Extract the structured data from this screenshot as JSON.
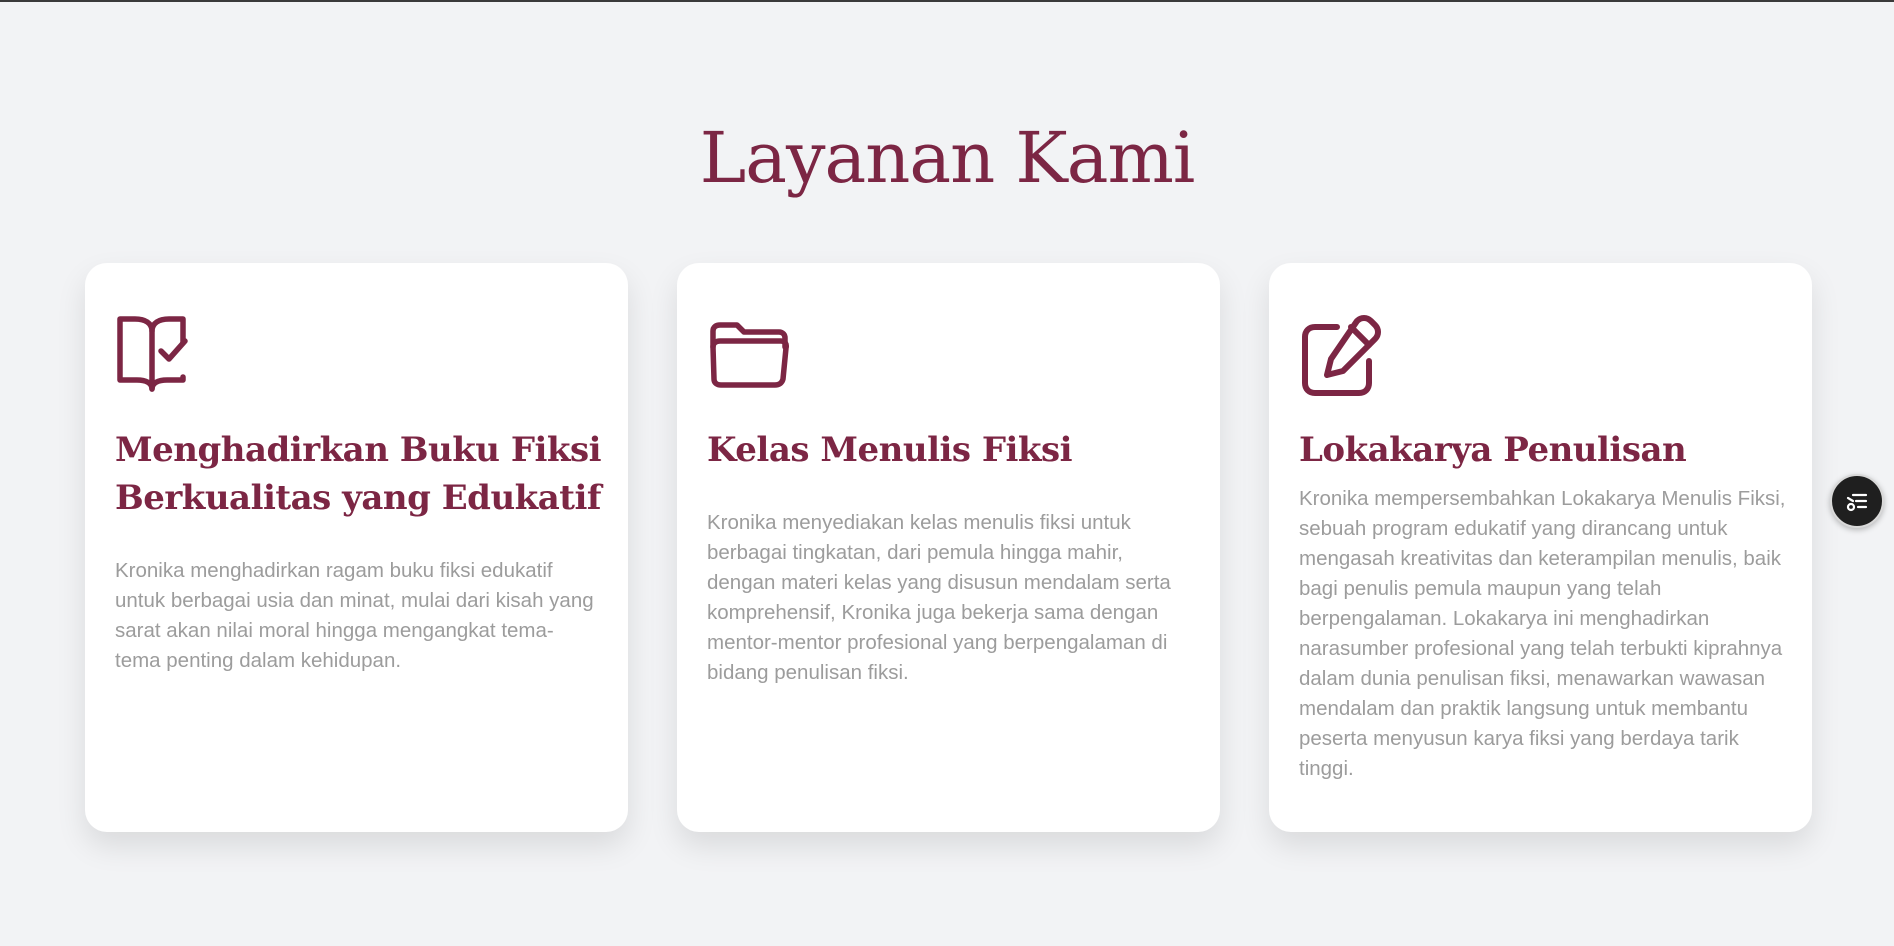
{
  "section": {
    "title": "Layanan Kami"
  },
  "services": [
    {
      "icon": "book-check-icon",
      "title": "Menghadirkan Buku Fiksi Berkualitas yang Edukatif",
      "description": "Kronika menghadirkan ragam buku fiksi edukatif untuk berbagai usia dan minat, mulai dari kisah yang sarat akan nilai moral hingga mengangkat tema-tema penting dalam kehidupan."
    },
    {
      "icon": "folder-open-icon",
      "title": "Kelas Menulis Fiksi",
      "description": "Kronika menyediakan kelas menulis fiksi untuk berbagai tingkatan, dari pemula hingga mahir, dengan materi kelas yang disusun mendalam serta komprehensif, Kronika juga bekerja sama dengan mentor-mentor profesional yang berpengalaman di bidang penulisan fiksi."
    },
    {
      "icon": "pencil-square-icon",
      "title": "Lokakarya Penulisan",
      "description": "Kronika mempersembahkan Lokakarya Menulis Fiksi, sebuah program edukatif yang dirancang untuk mengasah kreativitas dan keterampilan menulis, baik bagi penulis pemula maupun yang telah berpengalaman. Lokakarya ini menghadirkan narasumber profesional yang telah terbukti kiprahnya dalam dunia penulisan fiksi, menawarkan wawasan mendalam dan praktik langsung untuk membantu peserta menyusun karya fiksi yang berdaya tarik tinggi."
    }
  ],
  "floating_button": {
    "icon": "list-settings-icon"
  },
  "colors": {
    "accent": "#7c2644",
    "background": "#f2f3f5",
    "card": "#ffffff",
    "text_muted": "#9c9c9c"
  }
}
